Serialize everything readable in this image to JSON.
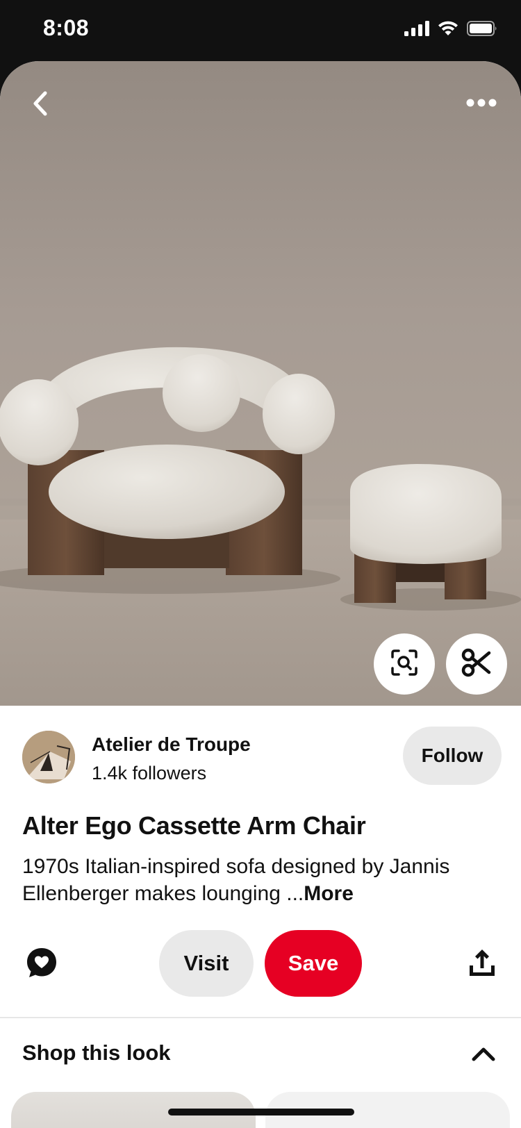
{
  "status_bar": {
    "time": "8:08",
    "icons": [
      "cellular-signal-icon",
      "wifi-icon",
      "battery-icon"
    ]
  },
  "hero": {
    "icons": {
      "back": "back-chevron-icon",
      "more": "more-dots-icon",
      "lens": "visual-search-icon",
      "cut": "scissors-icon"
    }
  },
  "creator": {
    "name": "Atelier de Troupe",
    "followers": "1.4k followers",
    "follow_label": "Follow"
  },
  "pin": {
    "title": "Alter Ego Cassette Arm Chair",
    "description": "1970s Italian-inspired sofa designed by Jannis Ellenberger makes lounging ...",
    "more_label": "More"
  },
  "actions": {
    "visit_label": "Visit",
    "save_label": "Save",
    "icons": {
      "comment": "comment-heart-icon",
      "share": "share-icon"
    }
  },
  "shop": {
    "title": "Shop this look",
    "chevron": "chevron-up-icon"
  },
  "colors": {
    "save_red": "#e60023",
    "secondary_button": "#e9e9e9",
    "status_bar_bg": "#111111"
  }
}
